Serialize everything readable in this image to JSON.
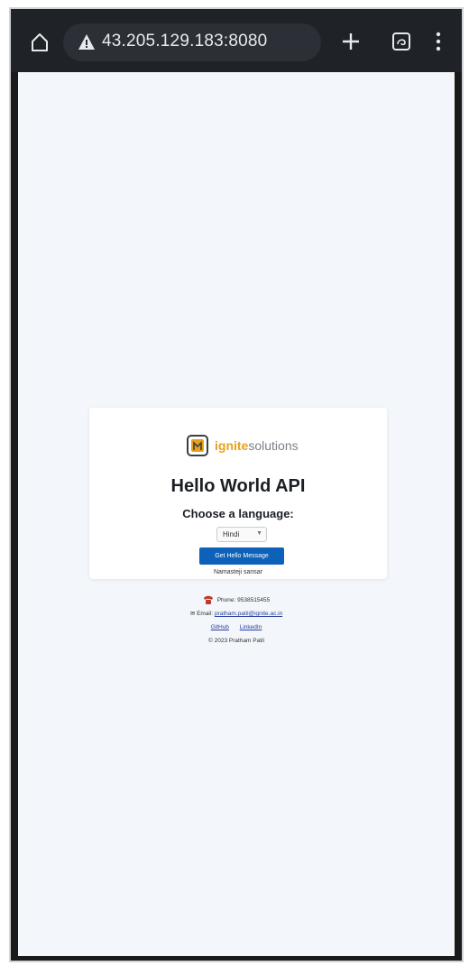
{
  "browser": {
    "url": "43.205.129.183:8080",
    "icons": [
      "home-icon",
      "warning-icon",
      "plus-icon",
      "tabs-icon",
      "menu-icon"
    ],
    "tab_count": ":)"
  },
  "card": {
    "logo_part1": "ignite",
    "logo_part2": "solutions",
    "title": "Hello World API",
    "choose_label": "Choose a language:",
    "selected_language": "Hindi",
    "button_label": "Get Hello Message",
    "status": "Namasteji sansar"
  },
  "footer": {
    "phone_label": "Phone: 9538515455",
    "email_prefix": "✉ Email:",
    "email": "pratham.patil@ignite.ac.in",
    "link_github": "GitHub",
    "link_linkedin": "LinkedIn",
    "copyright": "© 2023 Pratham Patil"
  },
  "colors": {
    "toolbar": "#1f2226",
    "page_bg": "#f3f6fa",
    "button": "#0d61b8",
    "logo_accent": "#e8a21a"
  }
}
